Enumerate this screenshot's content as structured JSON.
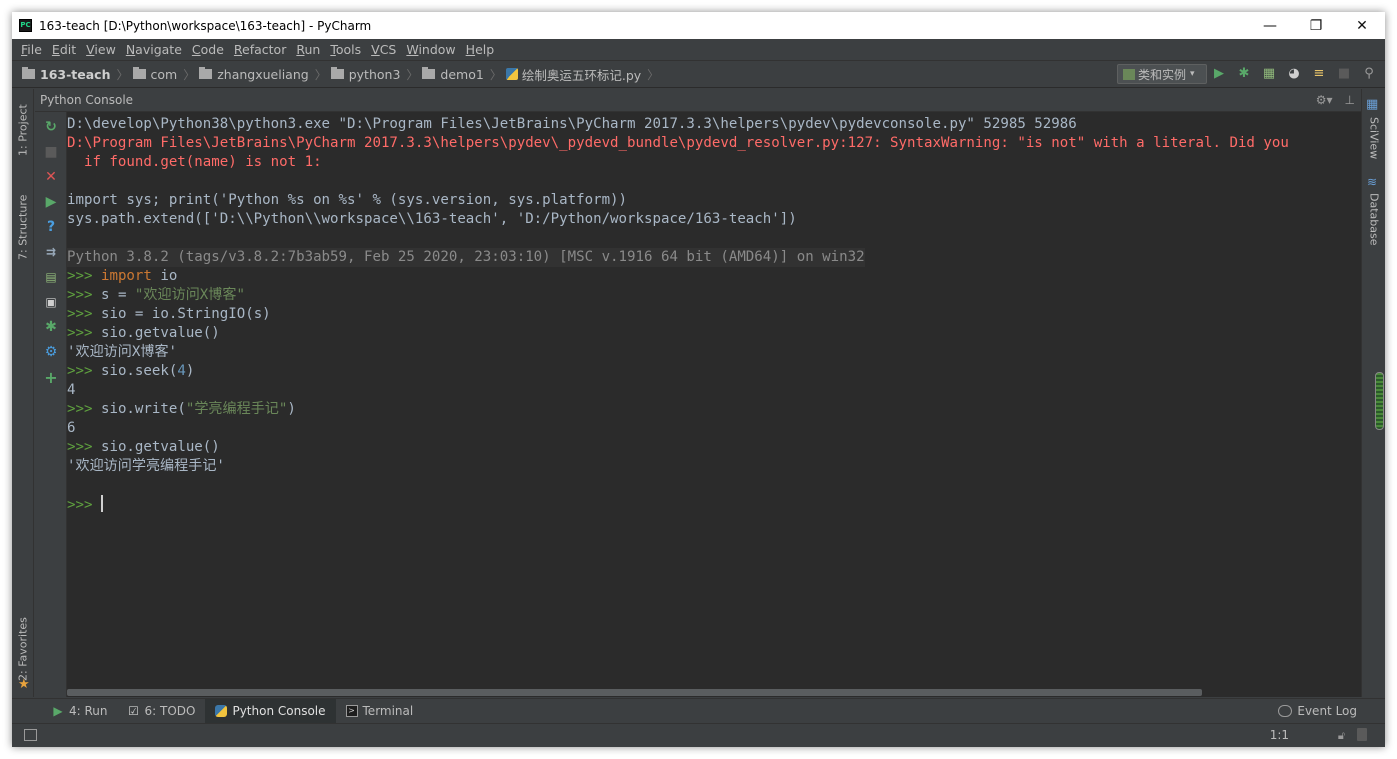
{
  "window": {
    "title": "163-teach [D:\\Python\\workspace\\163-teach] - PyCharm",
    "app_icon_label": "PC",
    "controls": {
      "minimize": "—",
      "restore": "❐",
      "close": "✕"
    }
  },
  "menu": [
    "File",
    "Edit",
    "View",
    "Navigate",
    "Code",
    "Refactor",
    "Run",
    "Tools",
    "VCS",
    "Window",
    "Help"
  ],
  "breadcrumbs": [
    {
      "label": "163-teach",
      "icon": "folder-icon"
    },
    {
      "label": "com",
      "icon": "folder-icon"
    },
    {
      "label": "zhangxueliang",
      "icon": "folder-icon"
    },
    {
      "label": "python3",
      "icon": "folder-icon"
    },
    {
      "label": "demo1",
      "icon": "folder-icon"
    },
    {
      "label": "绘制奥运五环标记.py",
      "icon": "python-file-icon"
    }
  ],
  "run_config": {
    "label": "类和实例",
    "caret": "▾"
  },
  "toolbar_icons": [
    "run-icon",
    "debug-icon",
    "coverage-icon",
    "profile-icon",
    "build-icon",
    "stop-icon",
    "search-icon"
  ],
  "left_tabs": [
    {
      "label": "1: Project"
    },
    {
      "label": "7: Structure"
    },
    {
      "label": "2: Favorites"
    }
  ],
  "right_tabs": [
    {
      "label": "SciView"
    },
    {
      "label": "Database"
    }
  ],
  "console": {
    "title": "Python Console",
    "lines": [
      {
        "text": "D:\\develop\\Python38\\python3.exe \"D:\\Program Files\\JetBrains\\PyCharm 2017.3.3\\helpers\\pydev\\pydevconsole.py\" 52985 52986",
        "style": "normal"
      },
      {
        "text": "D:\\Program Files\\JetBrains\\PyCharm 2017.3.3\\helpers\\pydev\\_pydevd_bundle\\pydevd_resolver.py:127: SyntaxWarning: \"is not\" with a literal. Did you",
        "style": "err"
      },
      {
        "text": "  if found.get(name) is not 1:",
        "style": "err"
      },
      {
        "text": "",
        "style": "normal"
      },
      {
        "text": "import sys; print('Python %s on %s' % (sys.version, sys.platform))",
        "style": "normal"
      },
      {
        "text": "sys.path.extend(['D:\\\\Python\\\\workspace\\\\163-teach', 'D:/Python/workspace/163-teach'])",
        "style": "normal"
      },
      {
        "text": "",
        "style": "normal"
      },
      {
        "text": "Python 3.8.2 (tags/v3.8.2:7b3ab59, Feb 25 2020, 23:03:10) [MSC v.1916 64 bit (AMD64)] on win32",
        "style": "gray"
      }
    ],
    "prompt": ">>>",
    "session": [
      {
        "kw": "import",
        "code": " io"
      },
      {
        "code": "s = ",
        "str": "\"欢迎访问X博客\""
      },
      {
        "code": "sio = io.StringIO(s)"
      },
      {
        "code": "sio.getvalue()",
        "output": "'欢迎访问X博客'"
      },
      {
        "code": "sio.seek(",
        "num": "4",
        "tail": ")",
        "output": "4"
      },
      {
        "code": "sio.write(",
        "str": "\"学亮编程手记\"",
        "tail": ")",
        "output": "6"
      },
      {
        "code": "sio.getvalue()",
        "output": "'欢迎访问学亮编程手记'"
      }
    ]
  },
  "bottom_tabs": [
    {
      "label": "4: Run",
      "icon": "run-icon"
    },
    {
      "label": "6: TODO",
      "icon": "todo-icon"
    },
    {
      "label": "Python Console",
      "icon": "python-icon"
    },
    {
      "label": "Terminal",
      "icon": "terminal-icon"
    }
  ],
  "event_log": "Event Log",
  "status": {
    "position": "1:1"
  }
}
